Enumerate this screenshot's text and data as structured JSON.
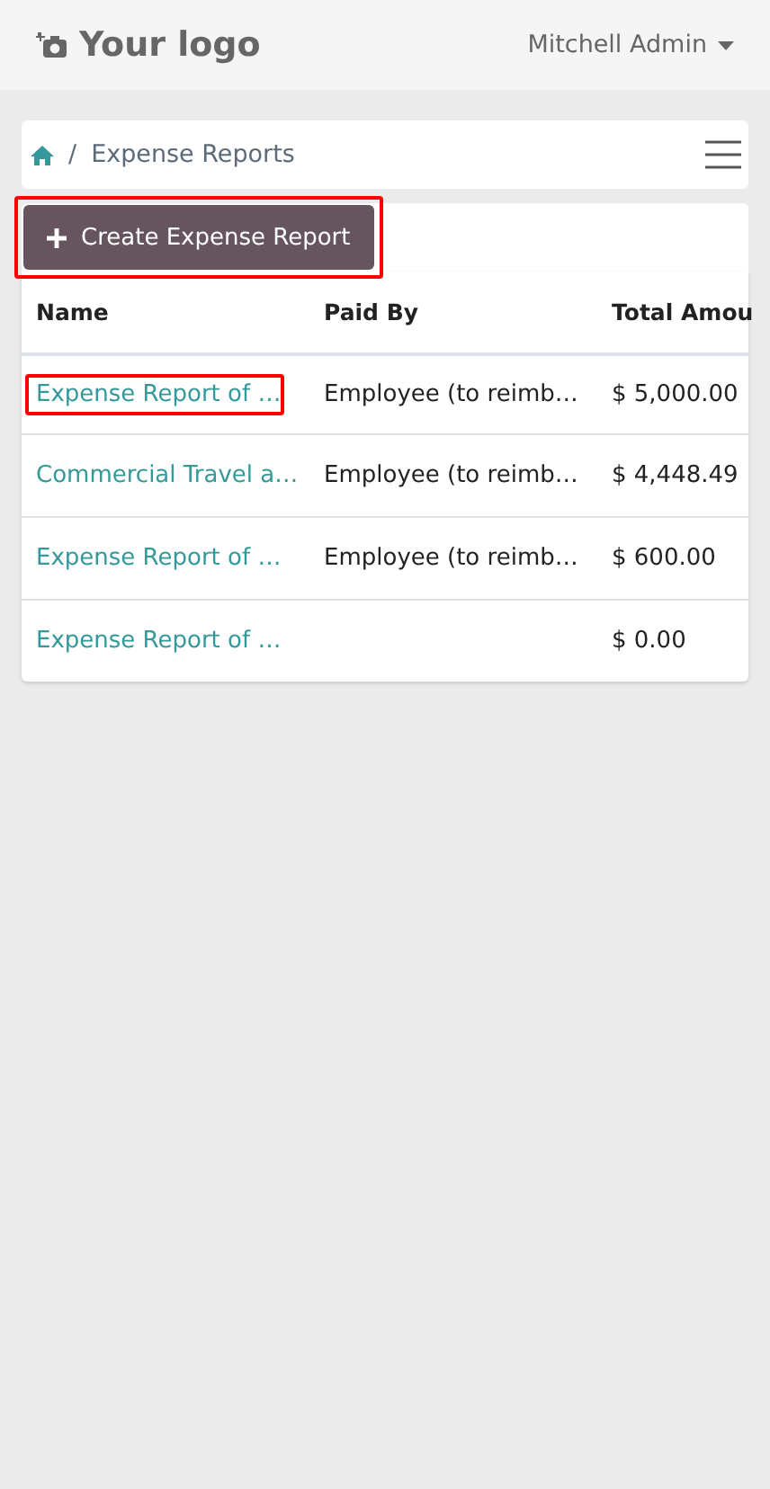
{
  "header": {
    "logo": "Your logo",
    "user": "Mitchell Admin"
  },
  "breadcrumb": {
    "items": [
      "/",
      "Expense Reports"
    ]
  },
  "create_button": {
    "label": "Create Expense Report",
    "highlighted": true
  },
  "table": {
    "columns": [
      "Name",
      "Paid By",
      "Total Amou"
    ],
    "rows": [
      {
        "name": "Expense Report of …",
        "paid_by": "Employee (to reimb…",
        "total": "$ 5,000.00",
        "highlighted": true
      },
      {
        "name": "Commercial Travel a…",
        "paid_by": "Employee (to reimb…",
        "total": "$ 4,448.49",
        "highlighted": false
      },
      {
        "name": "Expense Report of …",
        "paid_by": "Employee (to reimb…",
        "total": "$ 600.00",
        "highlighted": false
      },
      {
        "name": "Expense Report of …",
        "total": "$ 0.00",
        "highlighted": false
      }
    ]
  }
}
